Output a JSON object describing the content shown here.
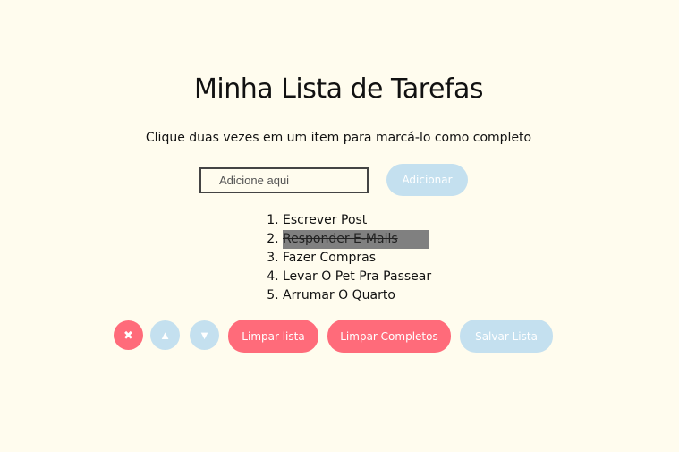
{
  "header": {
    "title": "Minha Lista de Tarefas",
    "instructions": "Clique duas vezes em um item para marcá-lo como completo"
  },
  "input": {
    "placeholder": "Adicione aqui",
    "value": ""
  },
  "add_button": {
    "label": "Adicionar"
  },
  "tasks": [
    {
      "text": "Escrever Post",
      "completed": false
    },
    {
      "text": "Responder E-Mails",
      "completed": true
    },
    {
      "text": "Fazer Compras",
      "completed": false
    },
    {
      "text": "Levar O Pet Pra Passear",
      "completed": false
    },
    {
      "text": "Arrumar O Quarto",
      "completed": false
    }
  ],
  "controls": {
    "delete_icon": "✖",
    "up_icon": "▲",
    "down_icon": "▼",
    "clear_list": "Limpar lista",
    "clear_completed": "Limpar Completos",
    "save_list": "Salvar Lista"
  },
  "colors": {
    "background": "#fffcee",
    "accent_red": "#ff6b7a",
    "accent_blue": "#c4e0ef",
    "completed_highlight": "#808080"
  }
}
